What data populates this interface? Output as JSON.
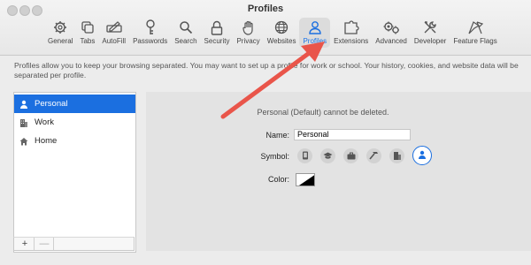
{
  "window": {
    "title": "Profiles"
  },
  "toolbar": {
    "items": [
      {
        "label": "General",
        "icon": "gear-icon"
      },
      {
        "label": "Tabs",
        "icon": "tabs-icon"
      },
      {
        "label": "AutoFill",
        "icon": "autofill-icon"
      },
      {
        "label": "Passwords",
        "icon": "key-icon"
      },
      {
        "label": "Search",
        "icon": "search-icon"
      },
      {
        "label": "Security",
        "icon": "lock-icon"
      },
      {
        "label": "Privacy",
        "icon": "hand-icon"
      },
      {
        "label": "Websites",
        "icon": "globe-icon"
      },
      {
        "label": "Profiles",
        "icon": "person-icon"
      },
      {
        "label": "Extensions",
        "icon": "puzzle-icon"
      },
      {
        "label": "Advanced",
        "icon": "gears-icon"
      },
      {
        "label": "Developer",
        "icon": "tools-icon"
      },
      {
        "label": "Feature Flags",
        "icon": "flags-icon"
      }
    ],
    "active": "Profiles"
  },
  "description": "Profiles allow you to keep your browsing separated. You may want to set up a profile for work or school. Your history, cookies, and website data will be separated per profile.",
  "profiles": {
    "items": [
      {
        "label": "Personal",
        "icon": "person-icon",
        "selected": true
      },
      {
        "label": "Work",
        "icon": "building-icon",
        "selected": false
      },
      {
        "label": "Home",
        "icon": "house-icon",
        "selected": false
      }
    ],
    "add_label": "+",
    "remove_label": "—"
  },
  "detail": {
    "note": "Personal (Default) cannot be deleted.",
    "name_label": "Name:",
    "name_value": "Personal",
    "symbol_label": "Symbol:",
    "symbols": [
      "phone-icon",
      "graduation-cap-icon",
      "briefcase-icon",
      "hammer-icon",
      "buildings-icon",
      "person-icon"
    ],
    "selected_symbol": "person-icon",
    "color_label": "Color:"
  },
  "colors": {
    "accent": "#1b6fe0",
    "arrow": "#e9554a"
  }
}
